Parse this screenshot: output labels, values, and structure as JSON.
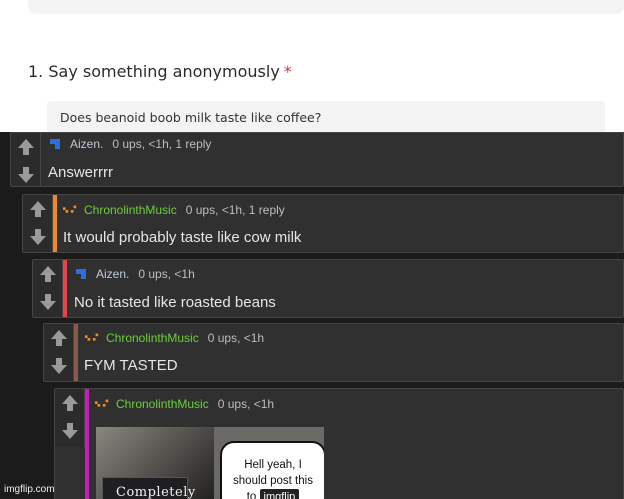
{
  "form": {
    "question_number": "1.",
    "question_text": "Say something anonymously",
    "required_marker": "*",
    "answer_text": "Does beanoid boob milk taste like coffee?"
  },
  "colors": {
    "blue_accent": "#2c6fe0",
    "orange_accent": "#f08a1e",
    "red_accent": "#e8434b",
    "brown_accent": "#8b5a4a",
    "magenta_accent": "#c91cbd",
    "username_green": "#6fce3c",
    "required_red": "#d13438"
  },
  "comments": [
    {
      "username": "Aizen.",
      "meta": "0 ups, <1h, 1 reply",
      "text": "Answerrrr",
      "user_icon": "blue-user-icon"
    },
    {
      "username": "ChronolinthMusic",
      "meta": "0 ups, <1h, 1 reply",
      "text": "It would probably taste like cow milk",
      "user_icon": "orange-user-icon"
    },
    {
      "username": "Aizen.",
      "meta": "0 ups, <1h",
      "text": "No it tasted like roasted beans",
      "user_icon": "blue-user-icon"
    },
    {
      "username": "ChronolinthMusic",
      "meta": "0 ups, <1h",
      "text": "FYM TASTED",
      "user_icon": "orange-user-icon"
    },
    {
      "username": "ChronolinthMusic",
      "meta": "0 ups, <1h",
      "text": "",
      "user_icon": "orange-user-icon"
    }
  ],
  "meme": {
    "caption": "Completely",
    "bubble_line1": "Hell yeah, I",
    "bubble_line2": "should post this",
    "bubble_line3": "to",
    "bubble_logo": "imgflip"
  },
  "watermark": "imgflip.com"
}
